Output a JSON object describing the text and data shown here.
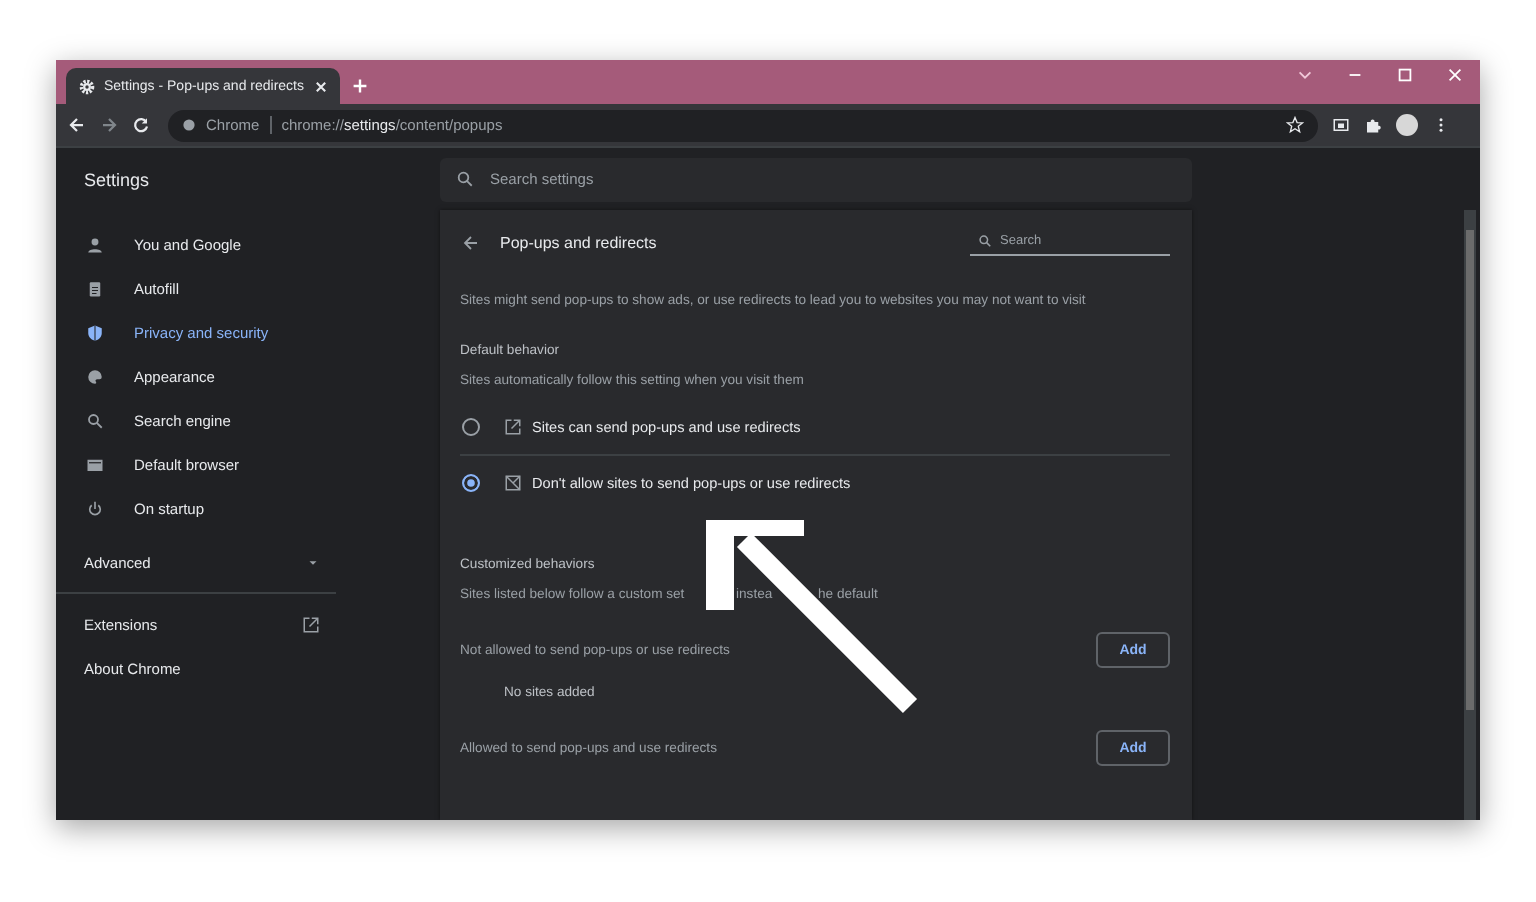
{
  "window": {
    "tab_title": "Settings - Pop-ups and redirects",
    "site_label": "Chrome",
    "url": "chrome://**settings**/content/popups"
  },
  "sidebar": {
    "title": "Settings",
    "items": [
      {
        "label": "You and Google",
        "selected": false
      },
      {
        "label": "Autofill",
        "selected": false
      },
      {
        "label": "Privacy and security",
        "selected": true
      },
      {
        "label": "Appearance",
        "selected": false
      },
      {
        "label": "Search engine",
        "selected": false
      },
      {
        "label": "Default browser",
        "selected": false
      },
      {
        "label": "On startup",
        "selected": false
      }
    ],
    "advanced": "Advanced",
    "extensions": "Extensions",
    "about": "About Chrome"
  },
  "search": {
    "placeholder": "Search settings"
  },
  "page": {
    "title": "Pop-ups and redirects",
    "search_placeholder": "Search",
    "description": "Sites might send pop-ups to show ads, or use redirects to lead you to websites you may not want to visit",
    "default_behavior": {
      "heading": "Default behavior",
      "subtitle": "Sites automatically follow this setting when you visit them",
      "options": [
        {
          "label": "Sites can send pop-ups and use redirects",
          "selected": false
        },
        {
          "label": "Don't allow sites to send pop-ups or use redirects",
          "selected": true
        }
      ]
    },
    "customized": {
      "heading": "Customized behaviors",
      "subtitle_parts": [
        "Sites listed below follow a custom set",
        "instea",
        "he default"
      ],
      "sections": [
        {
          "label": "Not allowed to send pop-ups or use redirects",
          "button": "Add",
          "empty_text": "No sites added"
        },
        {
          "label": "Allowed to send pop-ups and use redirects",
          "button": "Add"
        }
      ]
    }
  }
}
